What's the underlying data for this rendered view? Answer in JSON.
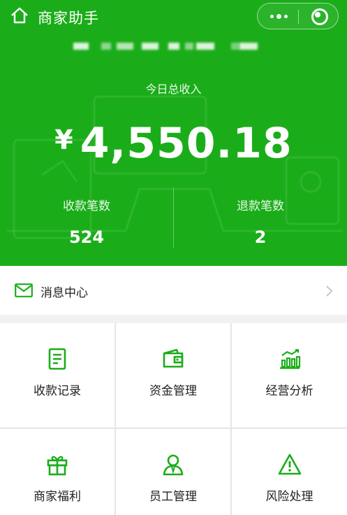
{
  "nav": {
    "title": "商家助手"
  },
  "account": {
    "masked_name": "",
    "blurred": true
  },
  "income": {
    "label": "今日总收入",
    "currency": "¥",
    "amount": "4,550.18"
  },
  "stats": [
    {
      "label": "收款笔数",
      "value": "524"
    },
    {
      "label": "退款笔数",
      "value": "2"
    }
  ],
  "message_center": {
    "label": "消息中心"
  },
  "menu": [
    {
      "label": "收款记录",
      "icon": "receipt-icon"
    },
    {
      "label": "资金管理",
      "icon": "wallet-icon"
    },
    {
      "label": "经营分析",
      "icon": "bar-chart-icon"
    },
    {
      "label": "商家福利",
      "icon": "gift-icon"
    },
    {
      "label": "员工管理",
      "icon": "staff-icon"
    },
    {
      "label": "风险处理",
      "icon": "warning-icon"
    }
  ],
  "colors": {
    "brand_green": "#1aad19",
    "icon_green": "#1aad19",
    "text": "#222222",
    "page_bg": "#f2f2f2"
  }
}
